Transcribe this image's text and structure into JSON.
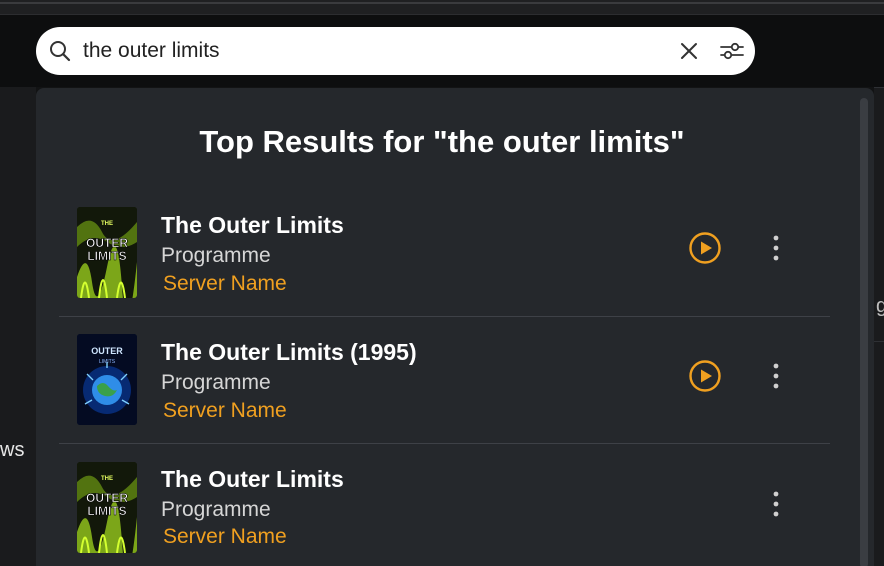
{
  "search": {
    "query": "the outer limits",
    "icons": {
      "search": "search-icon",
      "clear": "close-icon",
      "filter": "filter-sliders-icon"
    }
  },
  "background": {
    "left_fragment": "ws",
    "right_fragment": "g"
  },
  "results": {
    "heading": "Top Results for \"the outer limits\"",
    "items": [
      {
        "title": "The Outer Limits",
        "type": "Programme",
        "server": "Server Name",
        "poster": "outer-limits-poster",
        "has_play": true
      },
      {
        "title": "The Outer Limits (1995)",
        "type": "Programme",
        "server": "Server Name",
        "poster": "outer-limits-1995-poster",
        "has_play": true
      },
      {
        "title": "The Outer Limits",
        "type": "Programme",
        "server": "Server Name",
        "poster": "outer-limits-poster",
        "has_play": false
      }
    ]
  },
  "colors": {
    "accent": "#f0a020",
    "panel": "#25282c",
    "page": "#121314"
  }
}
